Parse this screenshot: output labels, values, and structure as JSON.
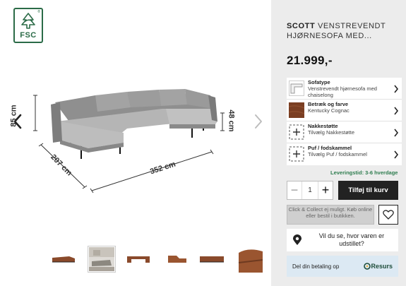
{
  "gallery": {
    "logo_text": "FSC",
    "logo_reg": "®",
    "dimensions": {
      "height": "85 cm",
      "depth": "207 cm",
      "width": "352 cm",
      "seat_height": "48 cm"
    },
    "thumbnails": [
      "corner-sofa-cognac-side",
      "living-room-scene",
      "u-sofa-cognac-top",
      "chaise-cognac",
      "sofa-cognac-front",
      "sofa-cognac-detail"
    ]
  },
  "product": {
    "brand": "SCOTT",
    "name": "VENSTREVENDT HJØRNESOFA MED...",
    "price": "21.999,-"
  },
  "options": [
    {
      "name": "Sofatype",
      "value": "Venstrevendt hjørnesofa med chaiselong",
      "icon": "sofa-shape-icon"
    },
    {
      "name": "Betræk og farve",
      "value": "Kentucky Cognac",
      "icon": "fabric-swatch-icon"
    },
    {
      "name": "Nakkestøtte",
      "value": "Tilvælg Nakkestøtte",
      "icon": "plus-box-icon"
    },
    {
      "name": "Puf / fodskammel",
      "value": "Tilvælg Puf / fodskammel",
      "icon": "plus-box-icon"
    }
  ],
  "delivery": "Leveringstid: 3-6 hverdage",
  "cart": {
    "quantity": "1",
    "minus": "−",
    "plus": "+",
    "add_label": "Tilføj til kurv"
  },
  "click_collect": "Click & Collect ej muligt. Køb online eller bestil i butikken.",
  "store_check": "Vil du se, hvor varen er udstillet?",
  "payment": {
    "label": "Del din betaling op",
    "provider": "Resurs"
  },
  "colors": {
    "panel_bg": "#ececec",
    "accent_dark": "#222222",
    "fsc_green": "#2b6b47",
    "delivery_green": "#2e7d4f",
    "pay_bg": "#dce9f3",
    "cognac": "#8a4a2b"
  }
}
